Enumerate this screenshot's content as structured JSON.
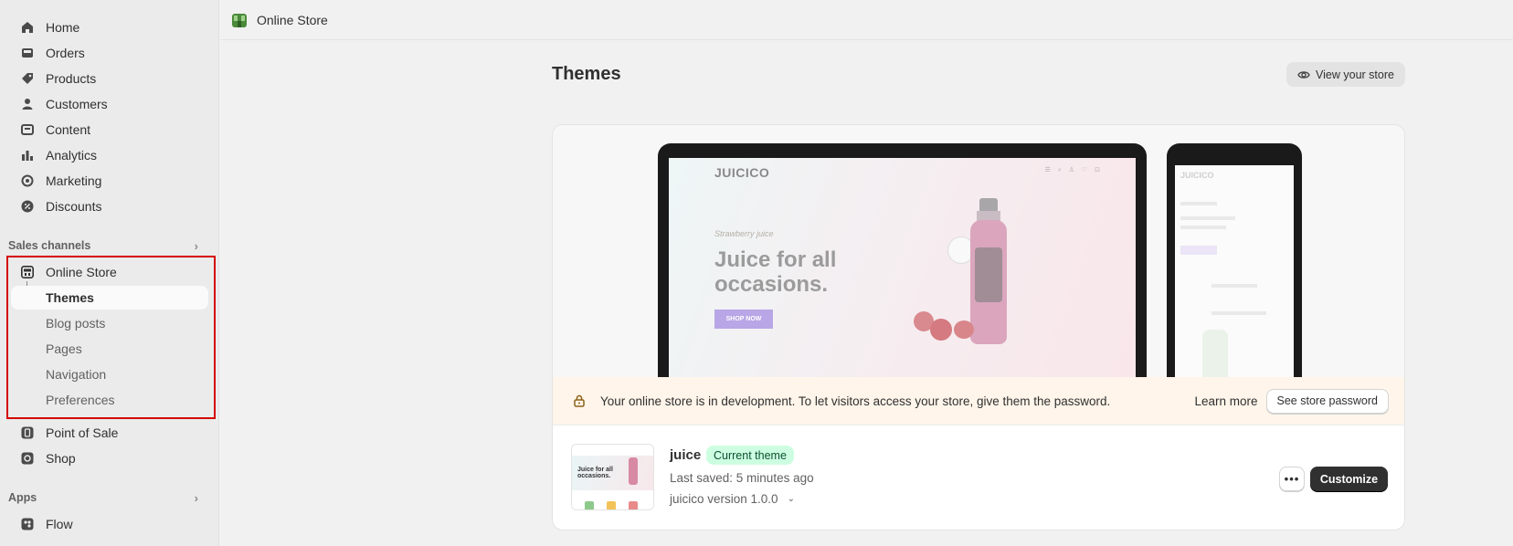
{
  "sidebar": {
    "main_items": [
      {
        "label": "Home",
        "icon": "home-icon"
      },
      {
        "label": "Orders",
        "icon": "inbox-icon"
      },
      {
        "label": "Products",
        "icon": "tag-icon"
      },
      {
        "label": "Customers",
        "icon": "person-icon"
      },
      {
        "label": "Content",
        "icon": "content-icon"
      },
      {
        "label": "Analytics",
        "icon": "bar-chart-icon"
      },
      {
        "label": "Marketing",
        "icon": "target-icon"
      },
      {
        "label": "Discounts",
        "icon": "discount-icon"
      }
    ],
    "sales_channels_heading": "Sales channels",
    "online_store": {
      "label": "Online Store",
      "sub_items": [
        "Themes",
        "Blog posts",
        "Pages",
        "Navigation",
        "Preferences"
      ],
      "active": "Themes"
    },
    "other_channels": [
      {
        "label": "Point of Sale",
        "icon": "pos-icon"
      },
      {
        "label": "Shop",
        "icon": "shop-icon"
      }
    ],
    "apps_heading": "Apps",
    "apps": [
      {
        "label": "Flow",
        "icon": "flow-icon"
      }
    ]
  },
  "topbar": {
    "title": "Online Store"
  },
  "page": {
    "title": "Themes",
    "view_store_label": "View your store"
  },
  "preview": {
    "brand": "JUICICO",
    "kicker": "Strawberry juice",
    "headline": "Juice for all occasions.",
    "cta": "SHOP NOW"
  },
  "banner": {
    "message": "Your online store is in development. To let visitors access your store, give them the password.",
    "learn_more": "Learn more",
    "password_button": "See store password"
  },
  "theme": {
    "name": "juice",
    "badge": "Current theme",
    "last_saved": "Last saved: 5 minutes ago",
    "version": "juicico version 1.0.0",
    "thumb_headline": "Juice for all occasions.",
    "customize_label": "Customize",
    "more_label": "•••"
  },
  "colors": {
    "accent_highlight": "#d50000",
    "badge_bg": "#cdfee1",
    "banner_bg": "#fff5ea",
    "primary_button": "#303030"
  }
}
